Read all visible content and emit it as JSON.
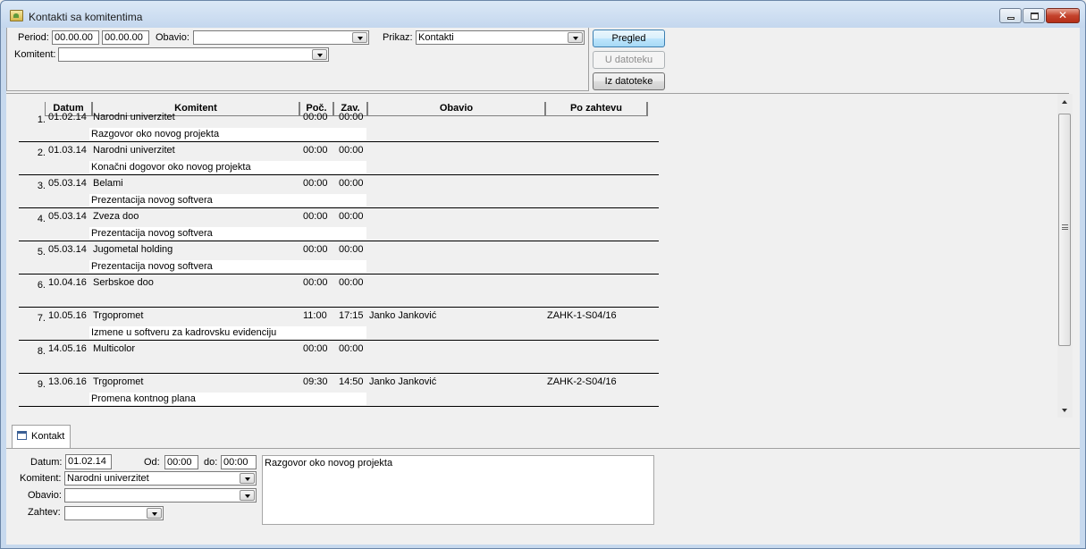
{
  "window": {
    "title": "Kontakti sa komitentima"
  },
  "filter": {
    "period_label": "Period:",
    "period_from": "00.00.00",
    "period_to": "00.00.00",
    "obavio_label": "Obavio:",
    "obavio_value": "",
    "prikaz_label": "Prikaz:",
    "prikaz_value": "Kontakti",
    "komitent_label": "Komitent:",
    "komitent_value": ""
  },
  "buttons": {
    "pregled": "Pregled",
    "u_datoteku": "U datoteku",
    "iz_datoteke": "Iz datoteke"
  },
  "grid": {
    "headers": [
      "Datum",
      "Komitent",
      "Poč.",
      "Zav.",
      "Obavio",
      "Po zahtevu"
    ],
    "rows": [
      {
        "n": "1.",
        "datum": "01.02.14",
        "komitent": "Narodni univerzitet",
        "poc": "00:00",
        "zav": "00:00",
        "obavio": "",
        "zahtev": "",
        "note": "Razgovor oko novog projekta"
      },
      {
        "n": "2.",
        "datum": "01.03.14",
        "komitent": "Narodni univerzitet",
        "poc": "00:00",
        "zav": "00:00",
        "obavio": "",
        "zahtev": "",
        "note": "Konačni dogovor oko novog projekta"
      },
      {
        "n": "3.",
        "datum": "05.03.14",
        "komitent": "Belami",
        "poc": "00:00",
        "zav": "00:00",
        "obavio": "",
        "zahtev": "",
        "note": "Prezentacija novog softvera"
      },
      {
        "n": "4.",
        "datum": "05.03.14",
        "komitent": "Zveza doo",
        "poc": "00:00",
        "zav": "00:00",
        "obavio": "",
        "zahtev": "",
        "note": "Prezentacija novog softvera"
      },
      {
        "n": "5.",
        "datum": "05.03.14",
        "komitent": "Jugometal holding",
        "poc": "00:00",
        "zav": "00:00",
        "obavio": "",
        "zahtev": "",
        "note": "Prezentacija novog softvera"
      },
      {
        "n": "6.",
        "datum": "10.04.16",
        "komitent": "Serbskoe doo",
        "poc": "00:00",
        "zav": "00:00",
        "obavio": "",
        "zahtev": "",
        "note": ""
      },
      {
        "n": "7.",
        "datum": "10.05.16",
        "komitent": "Trgopromet",
        "poc": "11:00",
        "zav": "17:15",
        "obavio": "Janko Janković",
        "zahtev": "ZAHK-1-S04/16",
        "note": "Izmene u softveru za kadrovsku evidenciju"
      },
      {
        "n": "8.",
        "datum": "14.05.16",
        "komitent": "Multicolor",
        "poc": "00:00",
        "zav": "00:00",
        "obavio": "",
        "zahtev": "",
        "note": ""
      },
      {
        "n": "9.",
        "datum": "13.06.16",
        "komitent": "Trgopromet",
        "poc": "09:30",
        "zav": "14:50",
        "obavio": "Janko Janković",
        "zahtev": "ZAHK-2-S04/16",
        "note": "Promena kontnog plana"
      }
    ]
  },
  "tab": {
    "label": "Kontakt"
  },
  "detail": {
    "datum_label": "Datum:",
    "datum_value": "01.02.14",
    "od_label": "Od:",
    "od_value": "00:00",
    "do_label": "do:",
    "do_value": "00:00",
    "komitent_label": "Komitent:",
    "komitent_value": "Narodni univerzitet",
    "obavio_label": "Obavio:",
    "obavio_value": "",
    "zahtev_label": "Zahtev:",
    "zahtev_value": "",
    "memo": "Razgovor oko novog projekta"
  }
}
